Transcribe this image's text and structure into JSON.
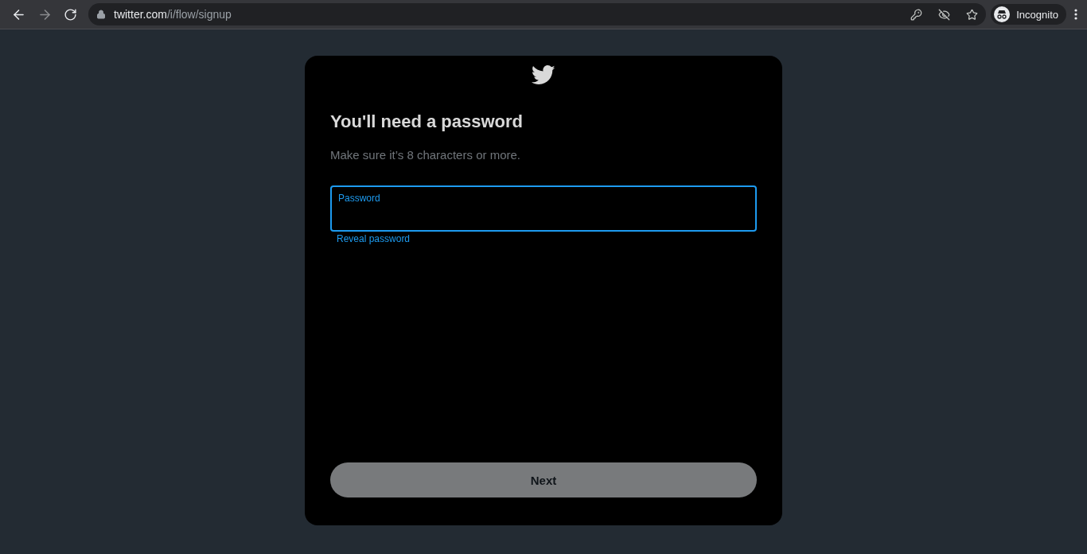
{
  "browser": {
    "url_host": "twitter.com",
    "url_path": "/i/flow/signup",
    "profile_label": "Incognito",
    "forward_disabled": true
  },
  "dialog": {
    "title": "You'll need a password",
    "subtitle": "Make sure it’s 8 characters or more.",
    "password_field": {
      "label": "Password",
      "focused": true
    },
    "reveal_link": "Reveal password",
    "next_button": {
      "label": "Next",
      "disabled": true
    }
  }
}
